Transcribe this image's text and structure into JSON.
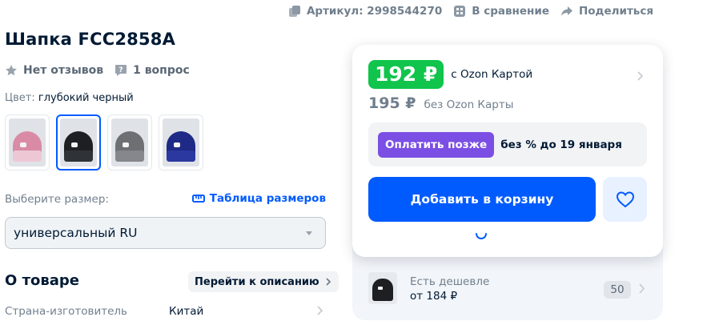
{
  "topbar": {
    "sku_label": "Артикул: 2998544270",
    "compare_label": "В сравнение",
    "share_label": "Поделиться"
  },
  "product": {
    "title": "Шапка FCC2858A",
    "reviews_label": "Нет отзывов",
    "questions_label": "1 вопрос",
    "color_prefix": "Цвет:",
    "color_value": "глубокий черный",
    "variants": [
      {
        "name": "pink",
        "color": "#d98ba6",
        "band": "#f0d2dc"
      },
      {
        "name": "black",
        "color": "#1e1f22",
        "band": "#33363b"
      },
      {
        "name": "gray",
        "color": "#6d6f73",
        "band": "#8a8c90"
      },
      {
        "name": "navy",
        "color": "#1e2a86",
        "band": "#2d3ba3"
      }
    ],
    "selected_variant_index": 1
  },
  "size": {
    "label": "Выберите размер:",
    "table_label": "Таблица размеров",
    "selected_value": "универсальный RU"
  },
  "about": {
    "title": "О товаре",
    "to_description_label": "Перейти к описанию",
    "specs": [
      {
        "key": "Страна-изготовитель",
        "value": "Китай"
      }
    ]
  },
  "price_card": {
    "price": "192 ₽",
    "price_note": "с Ozon Картой",
    "old_price": "195 ₽",
    "old_price_note": "без Ozon Карты",
    "pay_later_label": "Оплатить позже",
    "pay_later_note": "без % до 19 января",
    "add_to_cart_label": "Добавить в корзину"
  },
  "cheaper_offer": {
    "label": "Есть дешевле",
    "price": "от 184 ₽",
    "count": "50"
  },
  "colors": {
    "accent_blue": "#005bff",
    "price_green": "#10c44c",
    "pay_purple": "#7b4fe4",
    "muted_text": "#707f8d"
  }
}
